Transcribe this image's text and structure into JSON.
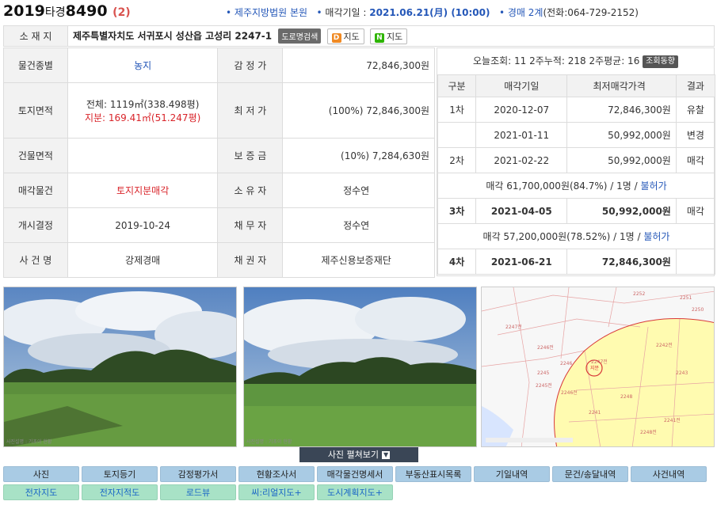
{
  "header": {
    "case_year": "2019",
    "case_type": "타경",
    "case_number": "8490",
    "case_seq": "(2)",
    "court": "제주지방법원 본원",
    "sale_date_label": "매각기일 :",
    "sale_date": "2021.06.21(月) (10:00)",
    "dept": "경매 2계",
    "phone": "(전화:064-729-2152)"
  },
  "address": {
    "label": "소 재 지",
    "value": "제주특별자치도 서귀포시 성산읍 고성리 2247-1",
    "road_btn": "도로명검색",
    "daum_map": "지도",
    "naver_map": "지도"
  },
  "info": {
    "item_type_label": "물건종별",
    "item_type": "농지",
    "appraisal_label": "감 정 가",
    "appraisal": "72,846,300원",
    "land_area_label": "토지면적",
    "land_total": "전체: 1119㎡(338.498평)",
    "land_share": "지분: 169.41㎡(51.247평)",
    "min_price_label": "최 저 가",
    "min_price": "(100%) 72,846,300원",
    "building_area_label": "건물면적",
    "building_area": "",
    "deposit_label": "보 증 금",
    "deposit": "(10%) 7,284,630원",
    "sale_item_label": "매각물건",
    "sale_item": "토지지분매각",
    "owner_label": "소 유 자",
    "owner": "정수연",
    "start_label": "개시결정",
    "start_date": "2019-10-24",
    "debtor_label": "채 무 자",
    "debtor": "정수연",
    "case_name_label": "사 건 명",
    "case_name": "강제경매",
    "creditor_label": "채 권 자",
    "creditor": "제주신용보증재단"
  },
  "views": {
    "text": "오늘조회: 11 2주누적: 218 2주평균: 16",
    "btn": "조회동향"
  },
  "history": {
    "headers": [
      "구분",
      "매각기일",
      "최저매각가격",
      "결과"
    ],
    "rows": [
      {
        "round": "1차",
        "date": "2020-12-07",
        "price": "72,846,300원",
        "result": "유찰"
      },
      {
        "round": "",
        "date": "2021-01-11",
        "price": "50,992,000원",
        "result": "변경"
      },
      {
        "round": "2차",
        "date": "2021-02-22",
        "price": "50,992,000원",
        "result": "매각"
      },
      {
        "round": "3차",
        "date": "2021-04-05",
        "price": "50,992,000원",
        "result": "매각"
      },
      {
        "round": "4차",
        "date": "2021-06-21",
        "price": "72,846,300원",
        "result": ""
      }
    ],
    "note1_text": "매각 61,700,000원(84.7%) / 1명 /",
    "note1_link": "불허가",
    "note2_text": "매각 57,200,000원(78.52%) / 1명 /",
    "note2_link": "불허가"
  },
  "photos": {
    "caption1": "사진설명 : 기초이 현황",
    "caption2": "사진설명 : 기초이 현황",
    "expand_label": "사진 펼쳐보기",
    "map_labels": [
      "2252",
      "2247전",
      "2246전",
      "2247전",
      "2245",
      "2245전",
      "2246",
      "2246전",
      "2242전",
      "2243",
      "2248",
      "2241전",
      "지분",
      "2251",
      "2250",
      "2241",
      "2248전"
    ]
  },
  "tabs": {
    "row1": [
      "사진",
      "토지등기",
      "감정평가서",
      "현황조사서",
      "매각물건명세서",
      "부동산표시목록",
      "기일내역",
      "문건/송달내역",
      "사건내역"
    ],
    "row2": [
      "전자지도",
      "전자지적도",
      "로드뷰",
      "씨:리얼지도+",
      "도시계획지도+"
    ]
  }
}
